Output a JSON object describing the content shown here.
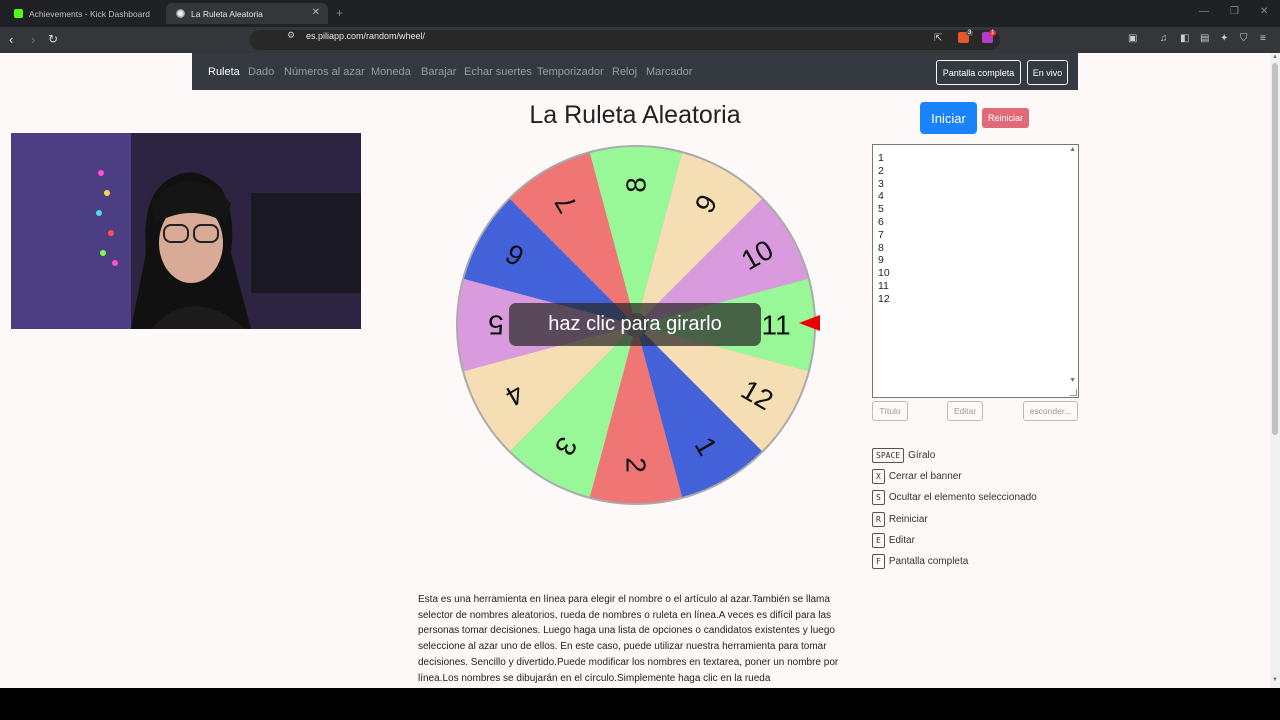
{
  "browser": {
    "tabs": [
      {
        "title": "Achievements - Kick Dashboard"
      },
      {
        "title": "La Ruleta Aleatoria"
      }
    ],
    "url": "es.piliapp.com/random/wheel/",
    "extension_badges": [
      "3",
      "1"
    ]
  },
  "site_nav": {
    "links": [
      {
        "label": "Ruleta"
      },
      {
        "label": "Dado"
      },
      {
        "label": "Números al azar"
      },
      {
        "label": "Moneda"
      },
      {
        "label": "Barajar"
      },
      {
        "label": "Echar suertes"
      },
      {
        "label": "Temporizador"
      },
      {
        "label": "Reloj"
      },
      {
        "label": "Marcador"
      }
    ],
    "fullscreen_label": "Pantalla completa",
    "live_label": "En vivo"
  },
  "main": {
    "title": "La Ruleta Aleatoria",
    "start_label": "Iniciar",
    "reset_label": "Reiniciar",
    "spin_prompt": "haz clic para girarlo"
  },
  "wheel": {
    "segments": [
      "1",
      "2",
      "3",
      "4",
      "5",
      "6",
      "7",
      "8",
      "9",
      "10",
      "11",
      "12"
    ],
    "colors": [
      "#4361d8",
      "#f07575",
      "#98f898",
      "#f5deb3",
      "#d99bde"
    ]
  },
  "names_list": [
    "1",
    "2",
    "3",
    "4",
    "5",
    "6",
    "7",
    "8",
    "9",
    "10",
    "11",
    "12"
  ],
  "tools": {
    "title_btn": "Título",
    "edit_btn": "Editar",
    "hide_btn": "esconder..."
  },
  "shortcuts": [
    {
      "key": "SPACE",
      "label": "Gíralo"
    },
    {
      "key": "X",
      "label": "Cerrar el banner"
    },
    {
      "key": "S",
      "label": "Ocultar el elemento seleccionado"
    },
    {
      "key": "R",
      "label": "Reiniciar"
    },
    {
      "key": "E",
      "label": "Editar"
    },
    {
      "key": "F",
      "label": "Pantalla completa"
    }
  ],
  "description": "Esta es una herramienta en línea para elegir el nombre o el artículo al azar.También se llama selector de nombres aleatorios, rueda de nombres o ruleta en línea.A veces es difícil para las personas tomar decisiones. Luego haga una lista de opciones o candidatos existentes y luego seleccione al azar uno de ellos. En este caso, puede utilizar nuestra herramienta para tomar decisiones. Sencillo y divertido.Puede modificar los nombres en textarea, poner un nombre por línea.Los nombres se dibujarán en el círculo.Simplemente haga clic en la rueda"
}
